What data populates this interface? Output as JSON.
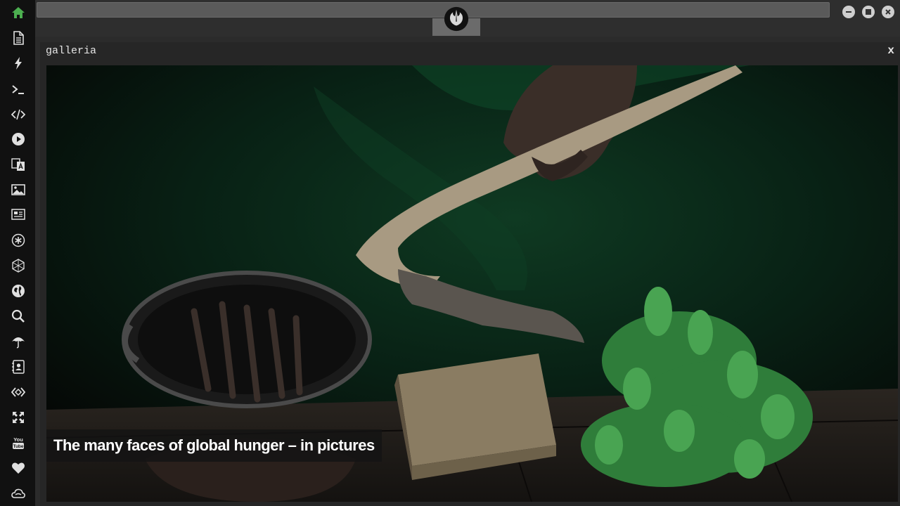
{
  "sidebar": {
    "items": [
      {
        "icon": "home-icon",
        "color": "#4caf50"
      },
      {
        "icon": "document-icon"
      },
      {
        "icon": "lightning-icon"
      },
      {
        "icon": "terminal-icon"
      },
      {
        "icon": "code-icon"
      },
      {
        "icon": "play-icon"
      },
      {
        "icon": "translate-icon"
      },
      {
        "icon": "image-icon"
      },
      {
        "icon": "news-icon"
      },
      {
        "icon": "asterisk-icon"
      },
      {
        "icon": "hexagon-network-icon"
      },
      {
        "icon": "globe-icon"
      },
      {
        "icon": "search-icon"
      },
      {
        "icon": "umbrella-icon"
      },
      {
        "icon": "contact-book-icon"
      },
      {
        "icon": "diamond-code-icon"
      },
      {
        "icon": "expand-icon"
      },
      {
        "icon": "youtube-icon"
      },
      {
        "icon": "heart-icon"
      },
      {
        "icon": "cloud-icon"
      }
    ]
  },
  "topbar": {
    "logo_icon": "rebel-alliance-icon",
    "window_controls": [
      "minimize-icon",
      "maximize-icon",
      "close-icon"
    ]
  },
  "panel": {
    "title": "galleria",
    "close_label": "x",
    "caption": "The many faces of global hunger – in pictures"
  },
  "colors": {
    "sidebar_bg": "#111111",
    "accent": "#4caf50",
    "panel_bg": "#262626"
  }
}
